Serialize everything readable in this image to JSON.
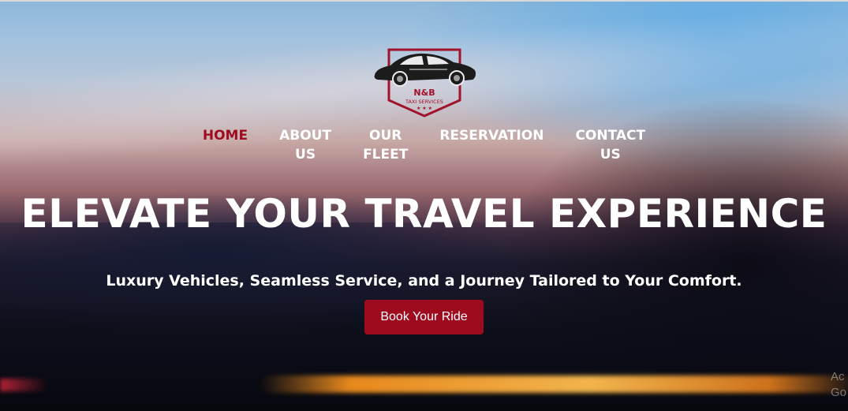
{
  "logo": {
    "brand": "N&B",
    "tagline": "TAXI SERVICES",
    "stars": "★ ★ ★",
    "icon": "sports-car-icon",
    "colors": {
      "frame": "#a0132a",
      "car": "#1a1a1a"
    }
  },
  "nav": {
    "items": [
      {
        "label": "HOME",
        "active": true
      },
      {
        "label": "ABOUT\nUS",
        "active": false
      },
      {
        "label": "OUR\nFLEET",
        "active": false
      },
      {
        "label": "RESERVATION",
        "active": false
      },
      {
        "label": "CONTACT\nUS",
        "active": false
      }
    ]
  },
  "hero": {
    "headline": "ELEVATE YOUR TRAVEL EXPERIENCE",
    "subheadline": "Luxury Vehicles, Seamless Service, and a Journey Tailored to Your Comfort.",
    "cta_label": "Book Your Ride"
  },
  "watermark": {
    "line1": "Ac",
    "line2": "Go"
  },
  "colors": {
    "accent": "#9e0b1f",
    "text": "#ffffff"
  }
}
